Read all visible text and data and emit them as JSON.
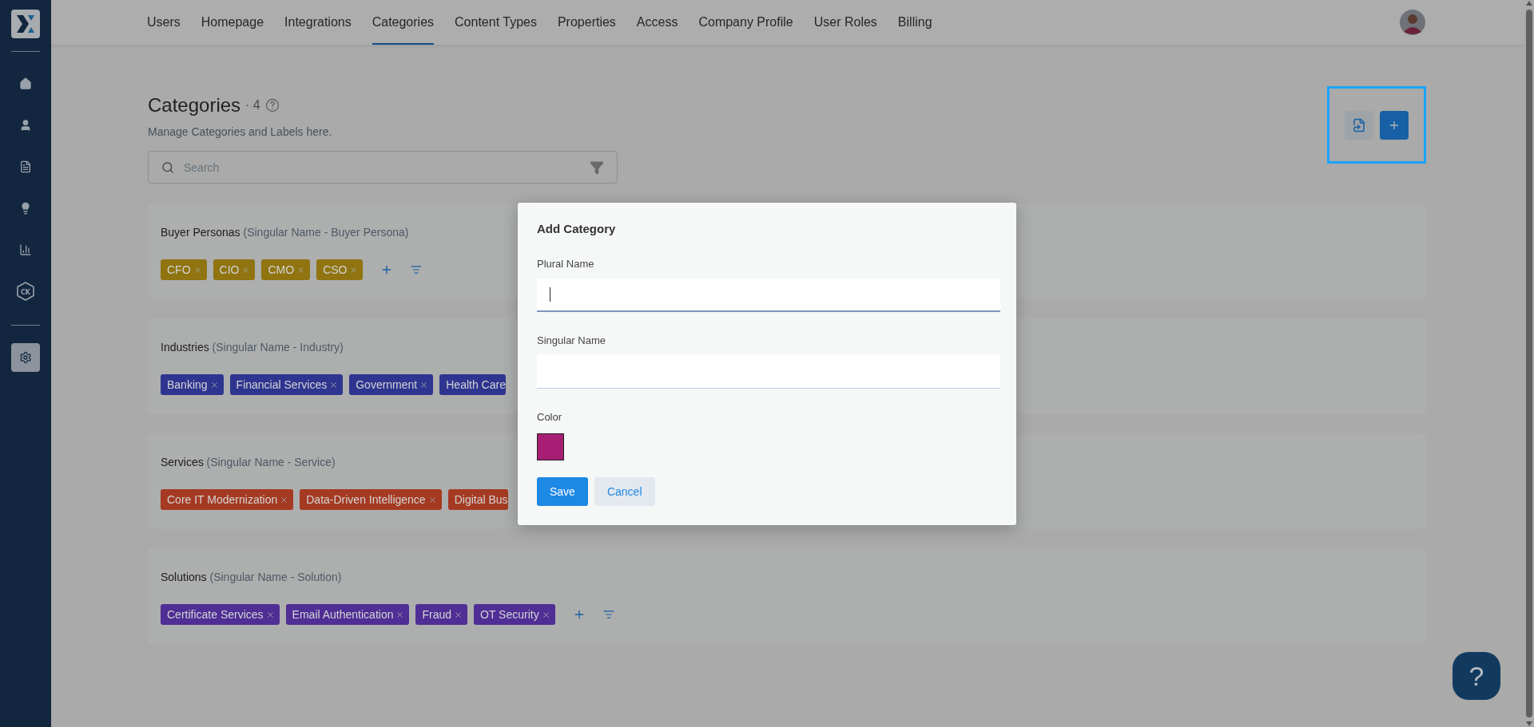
{
  "sidebar": {
    "items": [
      {
        "kind": "home",
        "selected": false
      },
      {
        "kind": "person",
        "selected": false
      },
      {
        "kind": "document",
        "selected": false
      },
      {
        "kind": "bulb",
        "selected": false
      },
      {
        "kind": "chart",
        "selected": false
      },
      {
        "kind": "hexagon",
        "label": "CK",
        "selected": false
      }
    ],
    "bottom_items": [
      {
        "kind": "settings",
        "selected": true
      }
    ]
  },
  "nav": {
    "tabs": [
      {
        "label": "Users",
        "selected": false
      },
      {
        "label": "Homepage",
        "selected": false
      },
      {
        "label": "Integrations",
        "selected": false
      },
      {
        "label": "Categories",
        "selected": true
      },
      {
        "label": "Content Types",
        "selected": false
      },
      {
        "label": "Properties",
        "selected": false
      },
      {
        "label": "Access",
        "selected": false
      },
      {
        "label": "Company Profile",
        "selected": false
      },
      {
        "label": "User Roles",
        "selected": false
      },
      {
        "label": "Billing",
        "selected": false
      }
    ]
  },
  "header": {
    "title": "Categories",
    "count": "· 4",
    "subtitle": "Manage Categories and Labels here.",
    "actions_highlighted": true
  },
  "search": {
    "placeholder": "Search"
  },
  "categories": [
    {
      "name": "Buyer Personas",
      "singular": "(Singular Name - Buyer Persona)",
      "color": "#8f7410",
      "actions": true,
      "tags": [
        {
          "label": "CFO",
          "kind": "chip"
        },
        {
          "label": "CIO",
          "kind": "chip"
        },
        {
          "label": "CMO",
          "kind": "chip"
        },
        {
          "label": "CSO",
          "kind": "chip"
        }
      ]
    },
    {
      "name": "Industries",
      "singular": "(Singular Name - Industry)",
      "color": "#2e3590",
      "tags": [
        {
          "label": "Banking",
          "kind": "chip"
        },
        {
          "label": "Financial Services",
          "kind": "chip"
        },
        {
          "label": "Government",
          "kind": "chip"
        },
        {
          "label": "Health Care",
          "kind": "cut"
        }
      ]
    },
    {
      "name": "Services",
      "singular": "(Singular Name - Service)",
      "color": "#a53a22",
      "tags": [
        {
          "label": "Core IT Modernization",
          "kind": "chip"
        },
        {
          "label": "Data-Driven Intelligence",
          "kind": "chip"
        },
        {
          "label": "Digital Bus",
          "kind": "cut"
        }
      ]
    },
    {
      "name": "Solutions",
      "singular": "(Singular Name - Solution)",
      "color": "#4f2e95",
      "actions": true,
      "tags": [
        {
          "label": "Certificate Services",
          "kind": "chip"
        },
        {
          "label": "Email Authentication",
          "kind": "chip"
        },
        {
          "label": "Fraud",
          "kind": "chip"
        },
        {
          "label": "OT Security",
          "kind": "chip"
        }
      ]
    }
  ],
  "modal": {
    "title": "Add Category",
    "fields": [
      {
        "label": "Plural Name",
        "focused": true
      },
      {
        "label": "Singular Name",
        "focused": false
      }
    ],
    "color": {
      "label": "Color",
      "color": "#a61e73"
    },
    "buttons": [
      {
        "label": "Save",
        "kind": "primary"
      },
      {
        "label": "Cancel",
        "kind": "secondary"
      }
    ]
  },
  "help": {
    "label": "?"
  }
}
